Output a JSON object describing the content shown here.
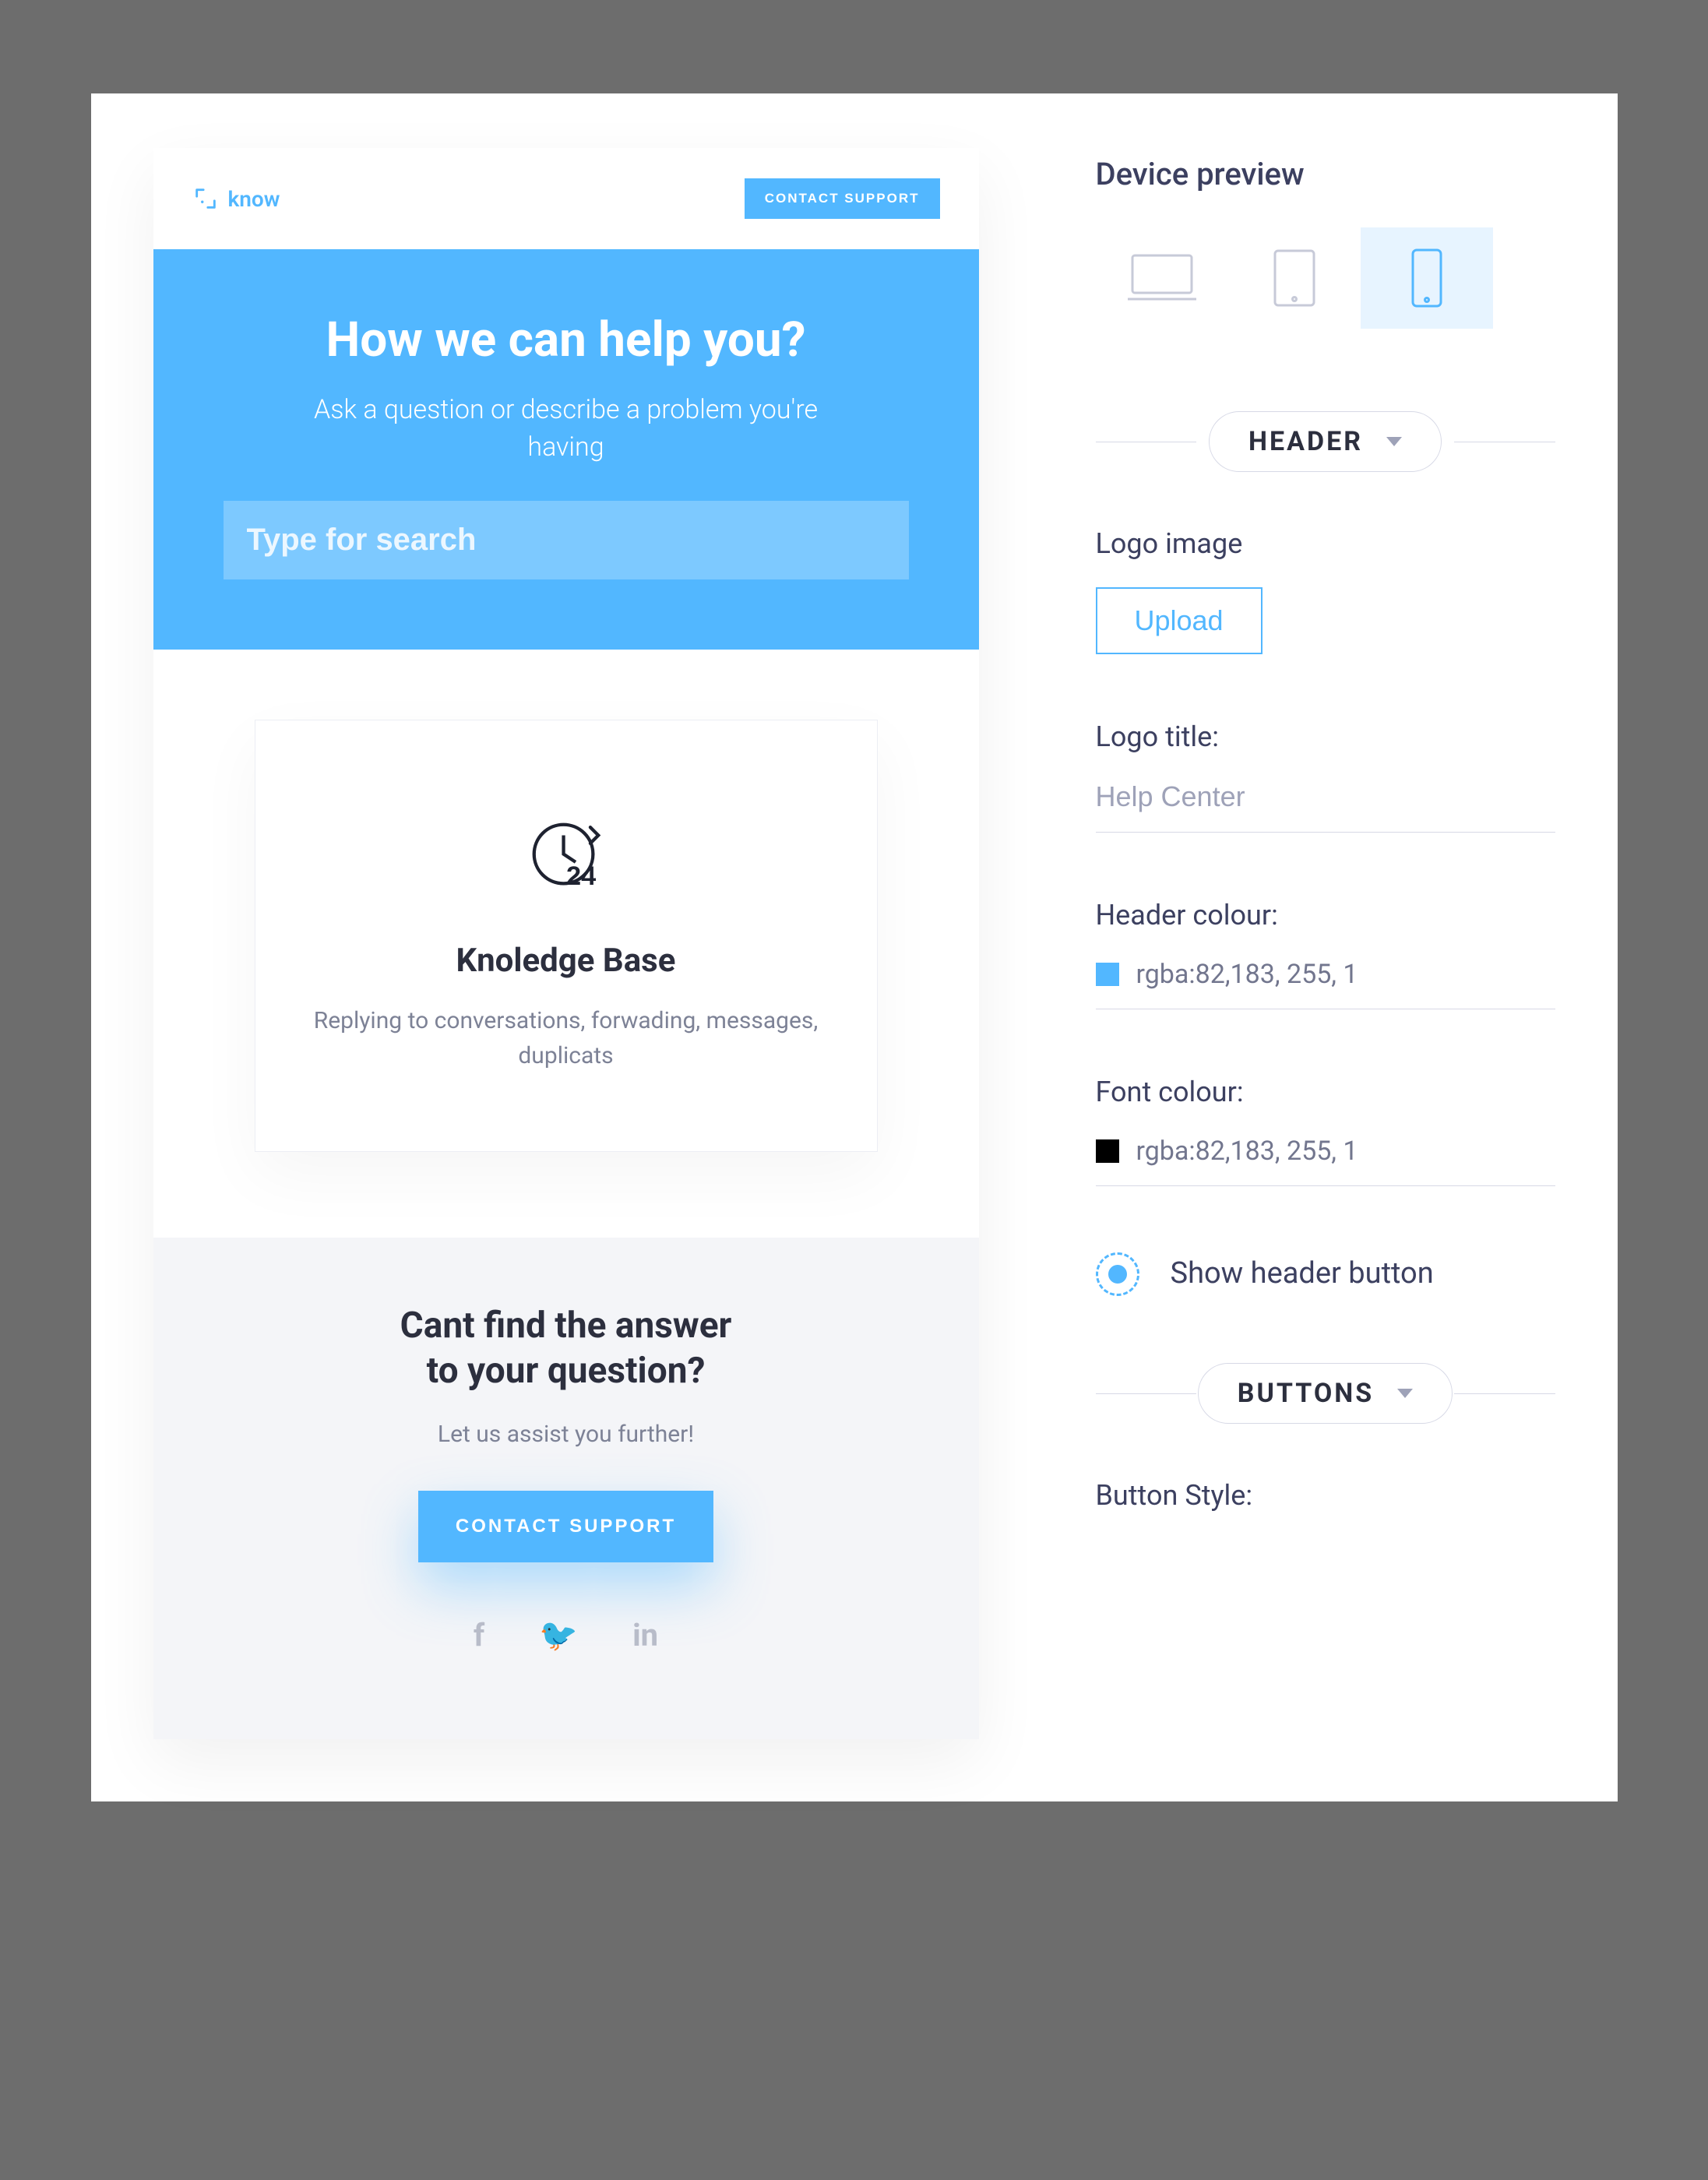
{
  "preview": {
    "logo_text": "know",
    "header_button": "CONTACT SUPPORT",
    "hero_title": "How we can help you?",
    "hero_subtitle": "Ask a question or describe a problem you're having",
    "search_placeholder": "Type for search",
    "kb_title": "Knoledge Base",
    "kb_desc": "Replying to conversations, forwading, messages, duplicats",
    "cta_title_l1": "Cant find the answer",
    "cta_title_l2": "to your question?",
    "cta_sub": "Let us assist you further!",
    "cta_button": "CONTACT SUPPORT"
  },
  "settings": {
    "device_preview_label": "Device preview",
    "sections": {
      "header": "HEADER",
      "buttons": "BUTTONS"
    },
    "logo_image_label": "Logo image",
    "upload_label": "Upload",
    "logo_title_label": "Logo title:",
    "logo_title_value": "Help Center",
    "header_colour_label": "Header colour:",
    "header_colour_value": "rgba:82,183, 255, 1",
    "header_colour_hex": "#52b7ff",
    "font_colour_label": "Font colour:",
    "font_colour_value": "rgba:82,183, 255, 1",
    "font_colour_hex": "#000000",
    "show_header_button_label": "Show header button",
    "button_style_label": "Button Style:"
  }
}
